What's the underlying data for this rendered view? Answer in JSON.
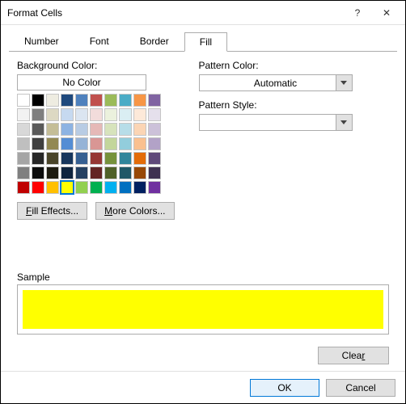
{
  "window": {
    "title": "Format Cells"
  },
  "tabs": {
    "t0": "Number",
    "t1": "Font",
    "t2": "Border",
    "t3": "Fill"
  },
  "labels": {
    "background_color": "Background Color:",
    "no_color": "No Color",
    "fill_effects_prefix": "F",
    "fill_effects_rest": "ill Effects...",
    "more_colors_prefix": "M",
    "more_colors_rest": "ore Colors...",
    "pattern_color": "Pattern Color:",
    "pattern_color_value": "Automatic",
    "pattern_style": "Pattern Style:",
    "sample": "Sample",
    "clear_prefix": "Clea",
    "clear_u": "r",
    "ok": "OK",
    "cancel": "Cancel"
  },
  "sample_color": "#ffff00",
  "swatches": {
    "row1": [
      "#ffffff",
      "#000000",
      "#eeece1",
      "#1f497d",
      "#4f81bd",
      "#c0504d",
      "#9bbb59",
      "#4bacc6",
      "#f79646",
      "#8064a2"
    ],
    "row2": [
      "#f2f2f2",
      "#7f7f7f",
      "#ddd9c3",
      "#c6d9f0",
      "#dbe5f1",
      "#f2dcdb",
      "#ebf1dd",
      "#daeef3",
      "#fde9d9",
      "#e5e0ec"
    ],
    "row3": [
      "#d8d8d8",
      "#595959",
      "#c4bd97",
      "#8db3e2",
      "#b8cce4",
      "#e5b9b7",
      "#d7e3bc",
      "#b7dde8",
      "#fbd5b5",
      "#ccc1d9"
    ],
    "row4": [
      "#bfbfbf",
      "#3f3f3f",
      "#938953",
      "#548dd4",
      "#95b3d7",
      "#d99694",
      "#c3d69b",
      "#92cddc",
      "#fac08f",
      "#b2a2c7"
    ],
    "row5": [
      "#a5a5a5",
      "#262626",
      "#494429",
      "#17365d",
      "#366092",
      "#953734",
      "#76923c",
      "#31859b",
      "#e36c09",
      "#5f497a"
    ],
    "row6": [
      "#7f7f7f",
      "#0c0c0c",
      "#1d1b10",
      "#0f243e",
      "#244061",
      "#632423",
      "#4f6128",
      "#205867",
      "#974806",
      "#3f3151"
    ],
    "row7": [
      "#c00000",
      "#ff0000",
      "#ffc000",
      "#ffff00",
      "#92d050",
      "#00b050",
      "#00b0f0",
      "#0070c0",
      "#002060",
      "#7030a0"
    ]
  }
}
